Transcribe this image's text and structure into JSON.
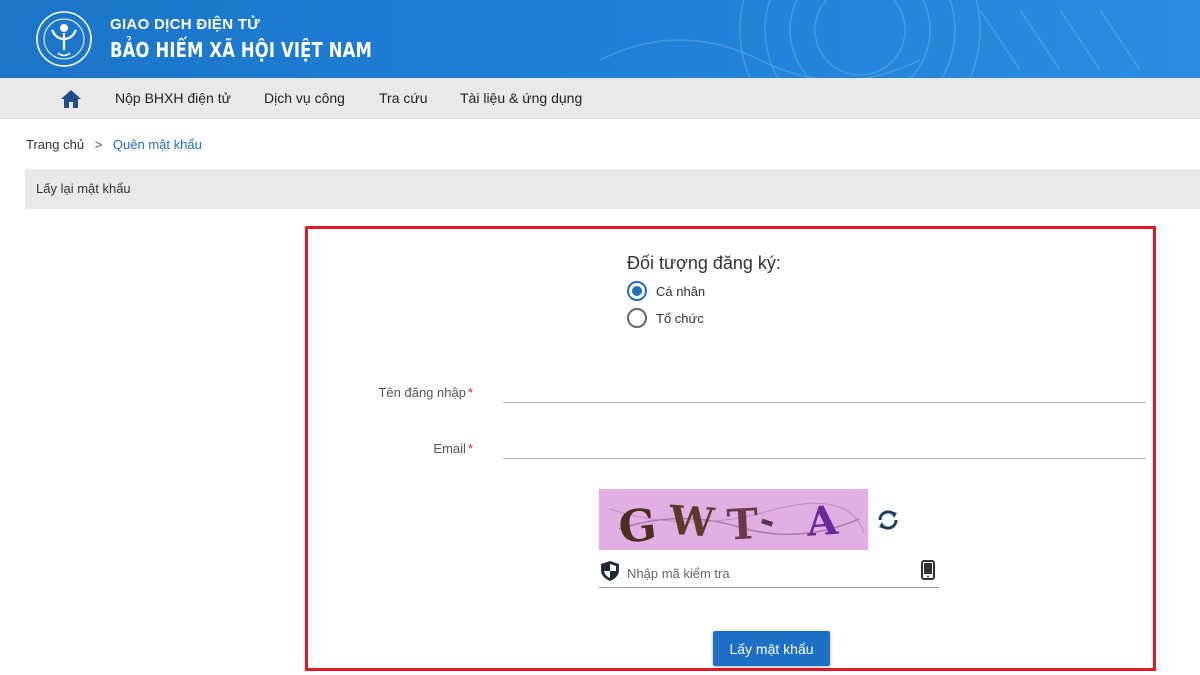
{
  "header": {
    "brand_top": "GIAO DỊCH ĐIỆN TỬ",
    "brand_main": "BẢO HIỂM XÃ HỘI VIỆT NAM",
    "logo_text": "BẢO HIỂM XÃ HỘI VIỆT NAM"
  },
  "nav": {
    "home_icon": "home-icon",
    "items": [
      {
        "label": "Nộp BHXH điện tử"
      },
      {
        "label": "Dịch vụ công"
      },
      {
        "label": "Tra cứu"
      },
      {
        "label": "Tài liệu & ứng dụng"
      }
    ]
  },
  "breadcrumb": {
    "home": "Trang chủ",
    "separator": ">",
    "current": "Quên mật khẩu"
  },
  "section": {
    "title": "Lấy lại mật khẩu"
  },
  "form": {
    "subject_title": "Đối tượng đăng ký:",
    "options": [
      {
        "label": "Cá nhân",
        "checked": true
      },
      {
        "label": "Tổ chức",
        "checked": false
      }
    ],
    "username": {
      "label": "Tên đăng nhập",
      "required_mark": "*",
      "value": ""
    },
    "email": {
      "label": "Email",
      "required_mark": "*",
      "value": ""
    },
    "captcha": {
      "text": "GWT-A",
      "placeholder": "Nhập mã kiểm tra",
      "refresh_icon": "refresh-icon",
      "shield_icon": "shield-icon",
      "phone_icon": "phone-icon"
    },
    "submit_label": "Lấy mật khẩu"
  },
  "colors": {
    "header_blue": "#1e7fd6",
    "accent_blue": "#1e6fb8",
    "highlight_red": "#e01b2a",
    "captcha_bg": "#e3aee3"
  }
}
